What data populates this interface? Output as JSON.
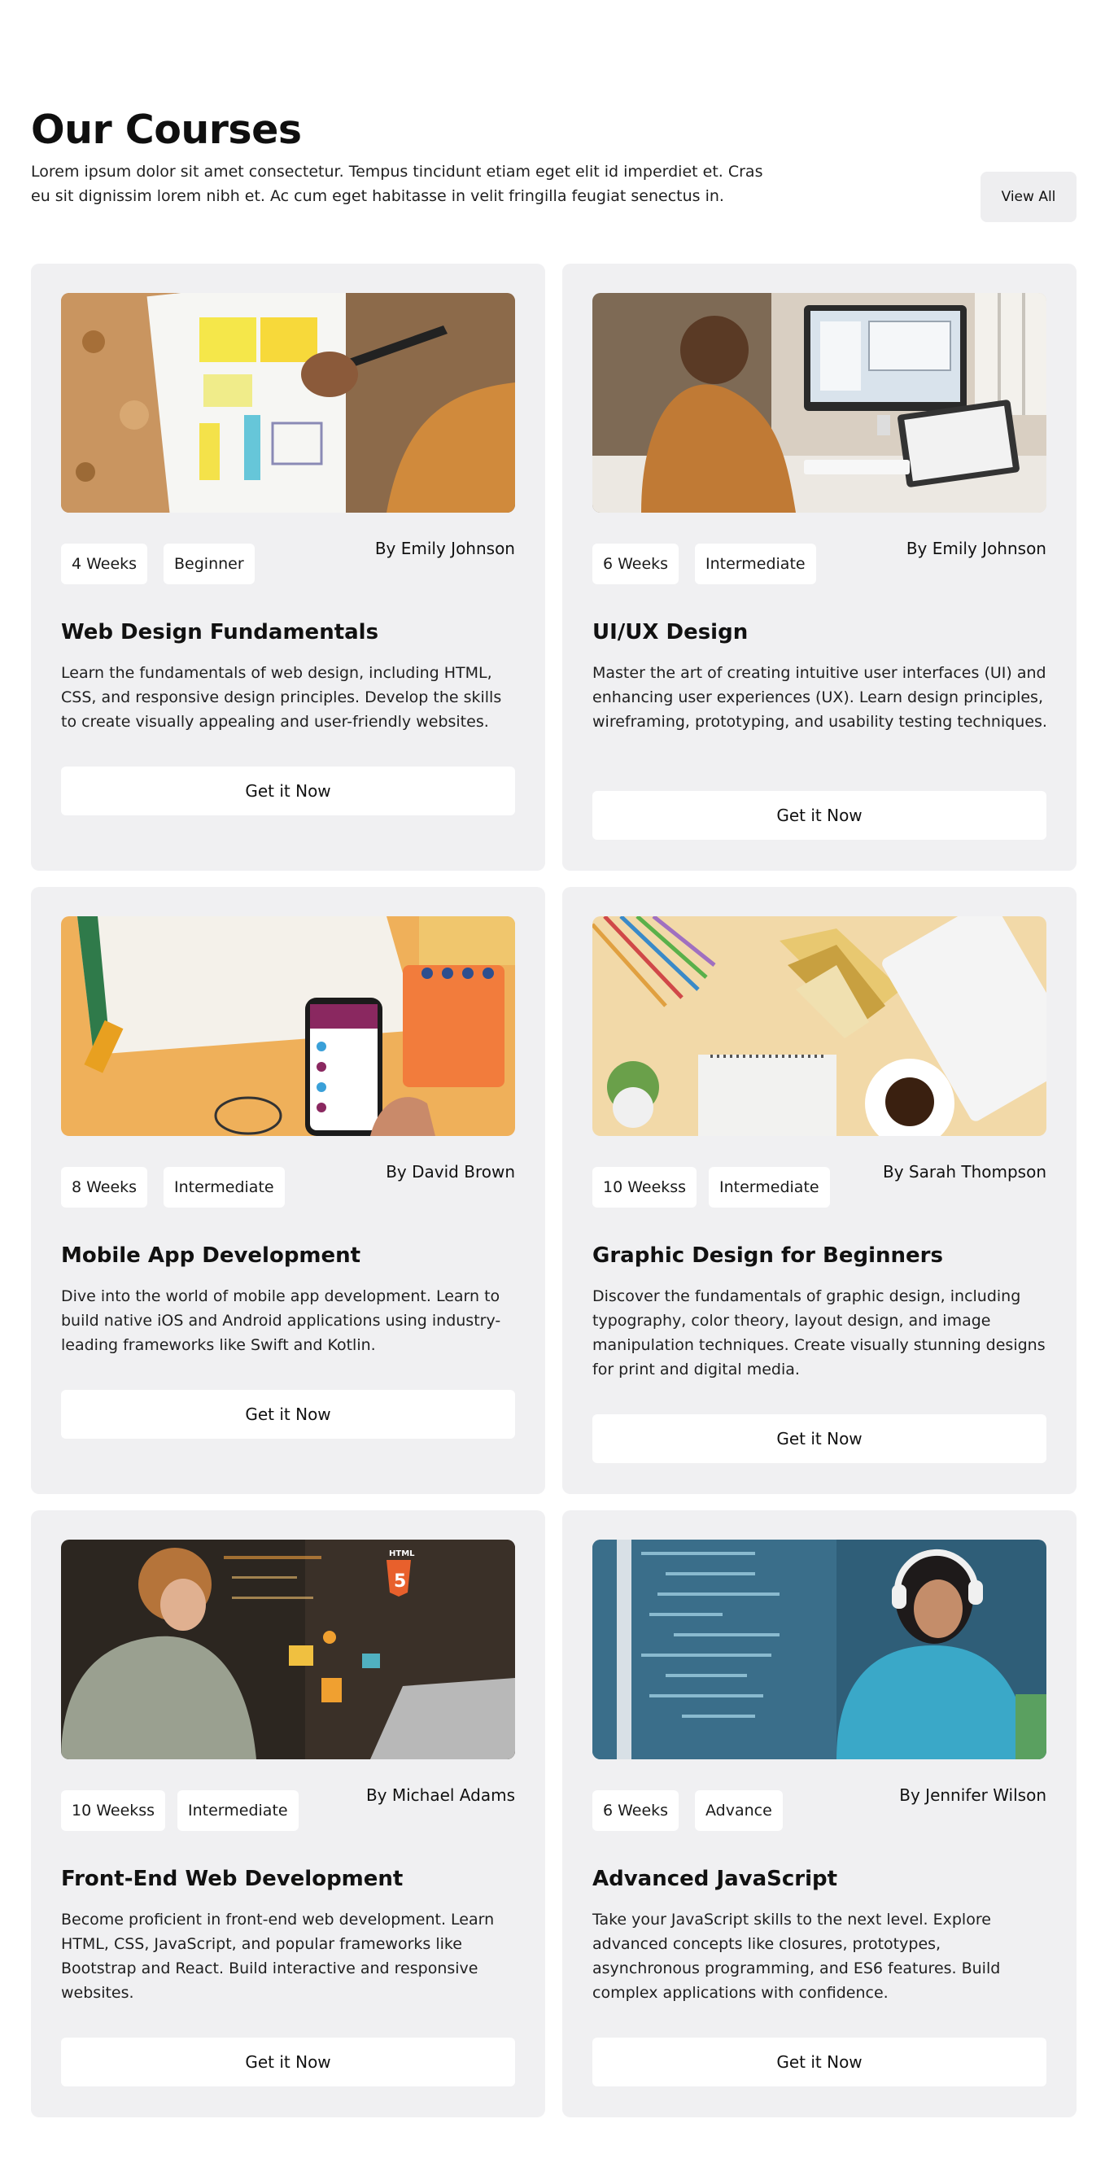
{
  "header": {
    "title": "Our Courses",
    "intro": "Lorem ipsum dolor sit amet consectetur. Tempus tincidunt etiam eget elit id imperdiet et. Cras eu sit dignissim lorem nibh et. Ac cum eget habitasse in velit fringilla feugiat senectus in.",
    "view_all_label": "View All"
  },
  "courses": [
    {
      "duration": "4 Weeks",
      "level": "Beginner",
      "author": "By Emily Johnson",
      "title": "Web Design Fundamentals",
      "description": "Learn the fundamentals of web design, including HTML, CSS, and responsive design principles. Develop the skills to create visually appealing and user-friendly websites.",
      "cta": "Get it Now"
    },
    {
      "duration": "6 Weeks",
      "level": "Intermediate",
      "author": "By Emily Johnson",
      "title": "UI/UX Design",
      "description": "Master the art of creating intuitive user interfaces (UI) and enhancing user experiences (UX). Learn design principles, wireframing, prototyping, and usability testing techniques.",
      "cta": "Get it Now"
    },
    {
      "duration": "8 Weeks",
      "level": "Intermediate",
      "author": "By David Brown",
      "title": "Mobile App Development",
      "description": "Dive into the world of mobile app development. Learn to build native iOS and Android applications using industry-leading frameworks like Swift and Kotlin.",
      "cta": "Get it Now"
    },
    {
      "duration": "10 Weekss",
      "level": "Intermediate",
      "author": "By Sarah Thompson",
      "title": "Graphic Design for Beginners",
      "description": "Discover the fundamentals of graphic design, including typography, color theory, layout design, and image manipulation techniques. Create visually stunning designs for print and digital media.",
      "cta": "Get it Now"
    },
    {
      "duration": "10 Weekss",
      "level": "Intermediate",
      "author": "By Michael Adams",
      "title": "Front-End Web Development",
      "description": "Become proficient in front-end web development. Learn HTML, CSS, JavaScript, and popular frameworks like Bootstrap and React. Build interactive and responsive websites.",
      "cta": "Get it Now"
    },
    {
      "duration": "6 Weeks",
      "level": "Advance",
      "author": "By Jennifer Wilson",
      "title": "Advanced JavaScript",
      "description": "Take your JavaScript skills to the next level. Explore advanced concepts like closures, prototypes, asynchronous programming, and ES6 features. Build complex applications with confidence.",
      "cta": "Get it Now"
    }
  ],
  "colors": {
    "card_background": "#f0f0f2",
    "button_background": "#ffffff",
    "page_background": "#ffffff"
  }
}
